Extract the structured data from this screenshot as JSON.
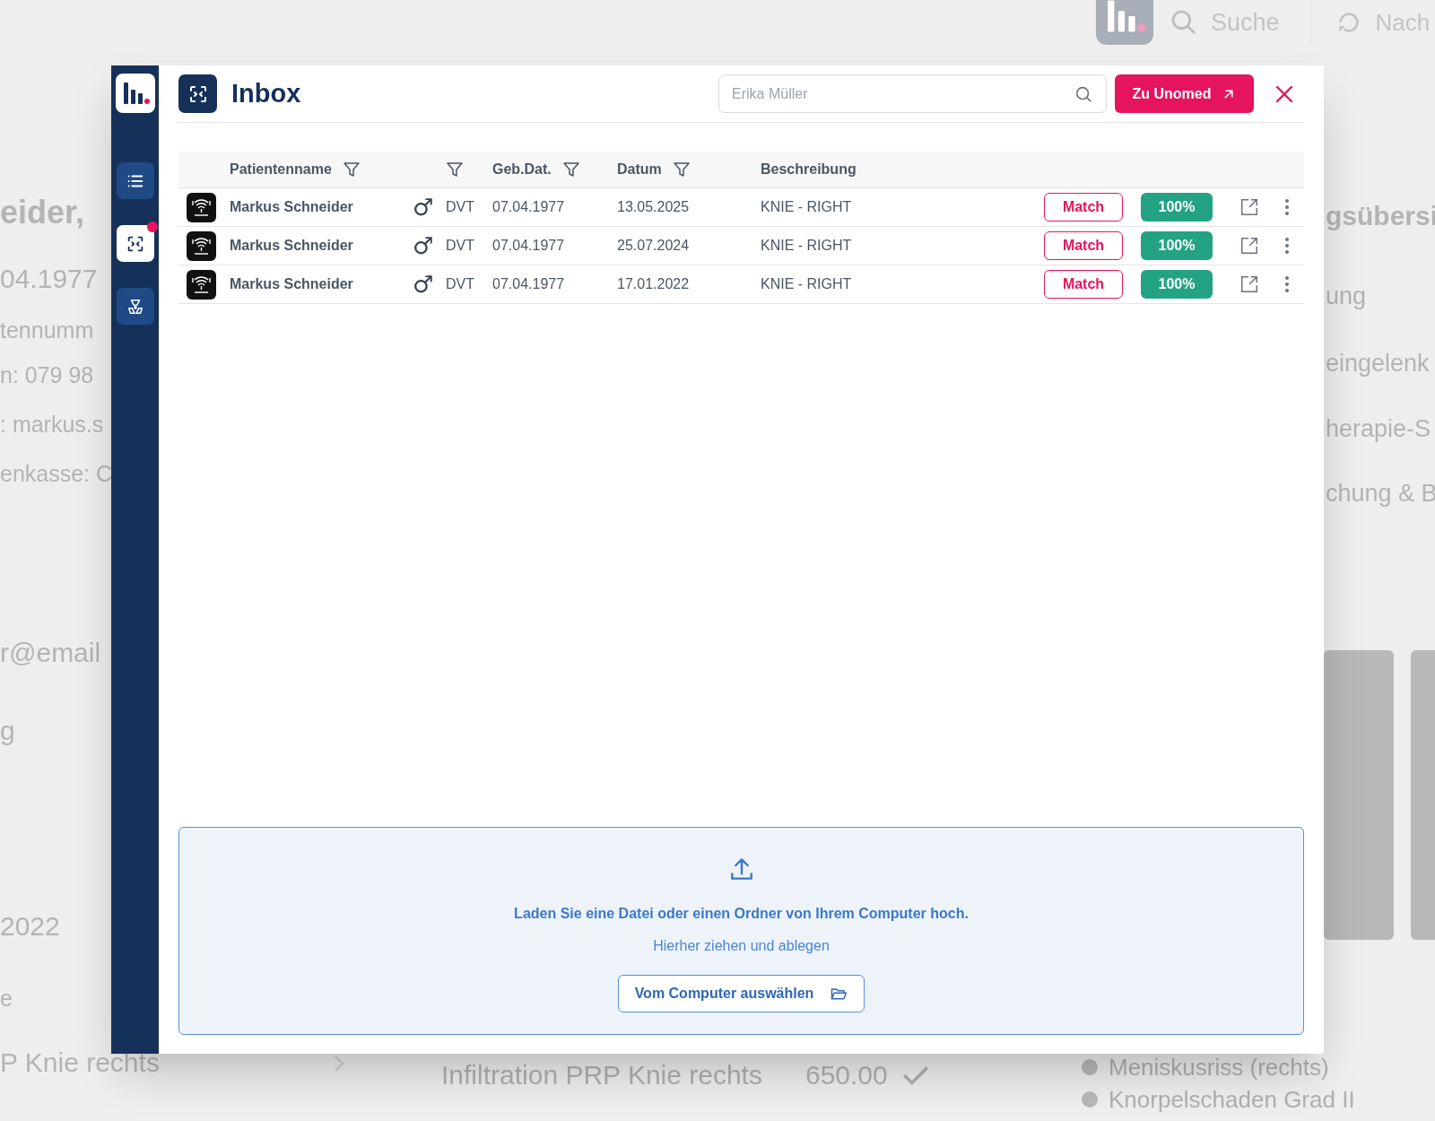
{
  "background": {
    "topbar": {
      "search_label": "Suche",
      "next_label": "Nach"
    },
    "left_texts": [
      {
        "text": "eider,",
        "kind": "heading"
      },
      {
        "text": "04.1977",
        "kind": "large"
      },
      {
        "text": "tennumm",
        "kind": "line"
      },
      {
        "text": "n: 079 98",
        "kind": "line"
      },
      {
        "text": ": markus.s",
        "kind": "line"
      },
      {
        "text": "enkasse: C",
        "kind": "line"
      },
      {
        "text": "r@email",
        "kind": "large"
      },
      {
        "text": "g",
        "kind": "large"
      },
      {
        "text": "2022",
        "kind": "large"
      },
      {
        "text": "e",
        "kind": "line"
      },
      {
        "text": "P Knie rechts",
        "kind": "large"
      }
    ],
    "right_texts": [
      {
        "text": "gsübersi",
        "kind": "heading"
      },
      {
        "text": "ung",
        "kind": "line"
      },
      {
        "text": "eingelenk",
        "kind": "line"
      },
      {
        "text": "herapie-S",
        "kind": "line"
      },
      {
        "text": "chung & B",
        "kind": "line"
      }
    ],
    "service": {
      "name": "Infiltration PRP Knie rechts",
      "price": "650.00"
    },
    "diagnoses": [
      "Meniskusriss (rechts)",
      "Knorpelschaden Grad II"
    ]
  },
  "sidebar": {
    "items": [
      {
        "kind": "list",
        "selected": false,
        "badge": false
      },
      {
        "kind": "scan",
        "selected": true,
        "badge": true
      },
      {
        "kind": "hazard",
        "selected": false,
        "badge": false
      }
    ]
  },
  "header": {
    "title": "Inbox",
    "search": {
      "placeholder": "Erika Müller"
    },
    "action": "Zu Unomed"
  },
  "table": {
    "columns": [
      {
        "label": "Patientenname",
        "filter": true
      },
      {
        "filter": true
      },
      {
        "label": "Geb.Dat.",
        "filter": true
      },
      {
        "label": "Datum",
        "filter": true
      },
      {
        "label": "Beschreibung",
        "filter": false
      }
    ],
    "rows": [
      {
        "name": "Markus Schneider",
        "sex": "♂",
        "modality": "DVT",
        "birth_date": "07.04.1977",
        "date": "13.05.2025",
        "description": "KNIE - RIGHT",
        "match": "Match",
        "score": "100%"
      },
      {
        "name": "Markus Schneider",
        "sex": "♂",
        "modality": "DVT",
        "birth_date": "07.04.1977",
        "date": "25.07.2024",
        "description": "KNIE - RIGHT",
        "match": "Match",
        "score": "100%"
      },
      {
        "name": "Markus Schneider",
        "sex": "♂",
        "modality": "DVT",
        "birth_date": "07.04.1977",
        "date": "17.01.2022",
        "description": "KNIE - RIGHT",
        "match": "Match",
        "score": "100%"
      }
    ]
  },
  "upload": {
    "title": "Laden Sie eine Datei oder einen Ordner von Ihrem Computer hoch.",
    "hint": "Hierher ziehen und ablegen",
    "button": "Vom Computer auswählen"
  }
}
